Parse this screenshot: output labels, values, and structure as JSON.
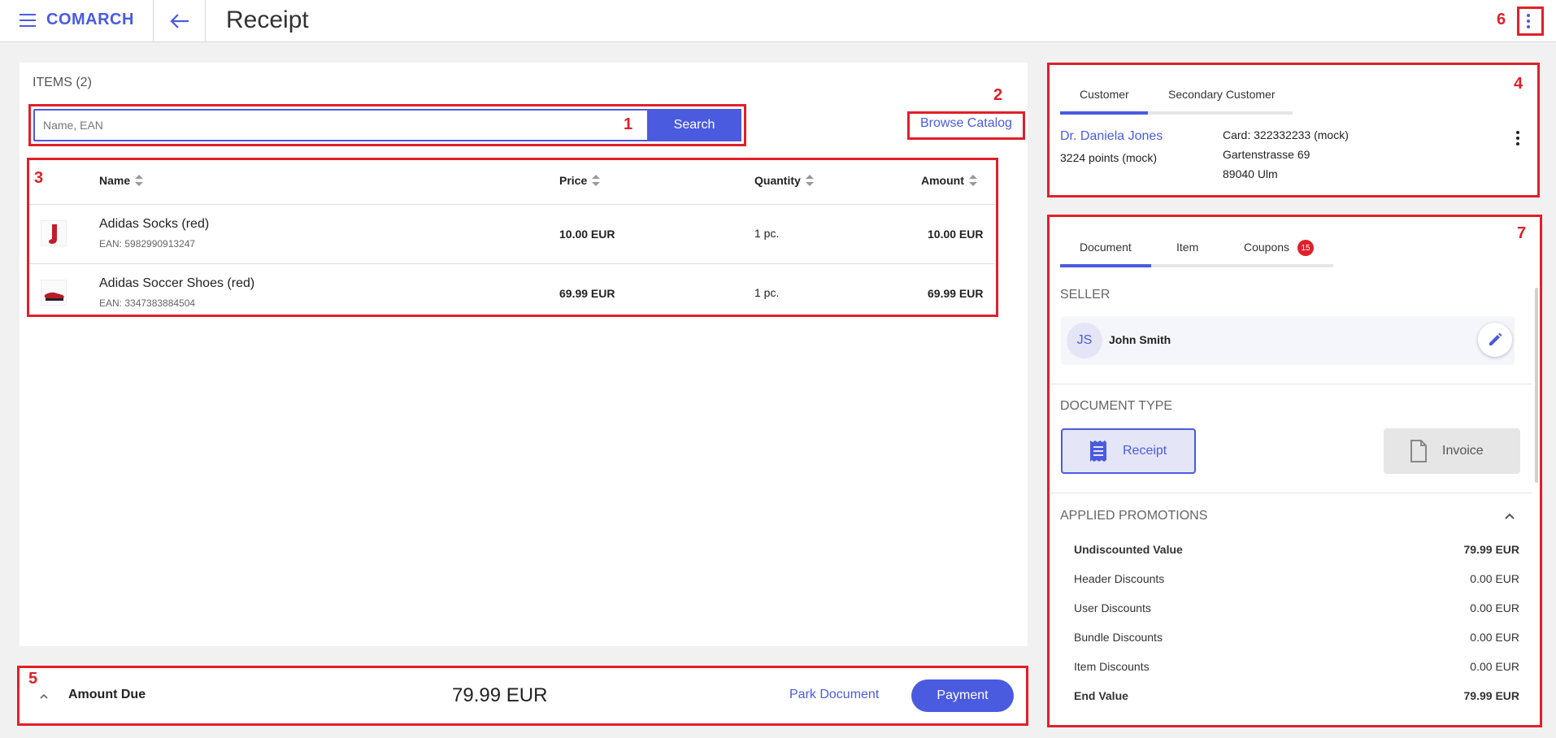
{
  "app": {
    "logo": "COMARCH",
    "title": "Receipt"
  },
  "items": {
    "title": "ITEMS (2)",
    "search_placeholder": "Name, EAN",
    "search_label": "Search",
    "browse_label": "Browse Catalog",
    "columns": [
      "Name",
      "Price",
      "Quantity",
      "Amount"
    ],
    "rows": [
      {
        "name": "Adidas Socks (red)",
        "ean": "EAN: 5982990913247",
        "price": "10.00 EUR",
        "qty": "1 pc.",
        "amount": "10.00 EUR"
      },
      {
        "name": "Adidas Soccer Shoes (red)",
        "ean": "EAN: 3347383884504",
        "price": "69.99 EUR",
        "qty": "1 pc.",
        "amount": "69.99 EUR"
      }
    ]
  },
  "customer": {
    "tabs": [
      "Customer",
      "Secondary Customer"
    ],
    "name": "Dr. Daniela Jones",
    "points": "3224 points (mock)",
    "card": "Card: 322332233 (mock)",
    "street": "Gartenstrasse 69",
    "city": "89040 Ulm"
  },
  "document": {
    "tabs": [
      "Document",
      "Item",
      "Coupons"
    ],
    "coupons_count": "15",
    "seller_title": "SELLER",
    "seller_initials": "JS",
    "seller_name": "John Smith",
    "doc_type_title": "DOCUMENT TYPE",
    "receipt_label": "Receipt",
    "invoice_label": "Invoice",
    "promotions_title": "APPLIED PROMOTIONS",
    "promotions": [
      {
        "label": "Undiscounted Value",
        "value": "79.99 EUR"
      },
      {
        "label": "Header Discounts",
        "value": "0.00 EUR"
      },
      {
        "label": "User Discounts",
        "value": "0.00 EUR"
      },
      {
        "label": "Bundle Discounts",
        "value": "0.00 EUR"
      },
      {
        "label": "Item Discounts",
        "value": "0.00 EUR"
      },
      {
        "label": "End Value",
        "value": "79.99 EUR"
      }
    ]
  },
  "footer": {
    "amount_label": "Amount Due",
    "amount_value": "79.99 EUR",
    "park_label": "Park Document",
    "payment_label": "Payment"
  },
  "annotations": [
    "1",
    "2",
    "3",
    "4",
    "5",
    "6",
    "7"
  ],
  "colors": {
    "accent": "#4a5be0",
    "annotation": "#e0202a"
  }
}
